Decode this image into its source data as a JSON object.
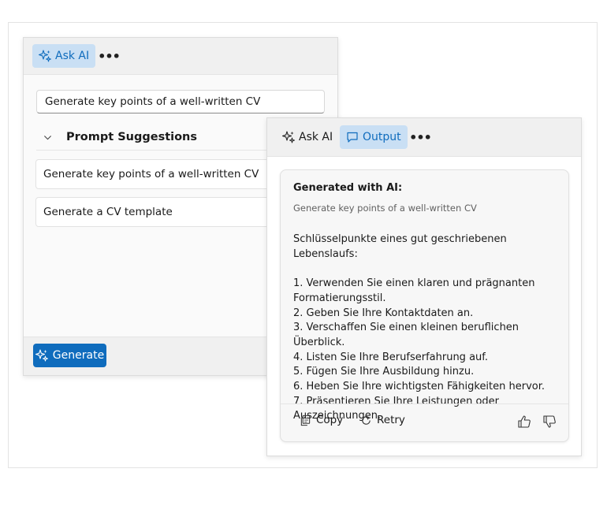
{
  "left_panel": {
    "toolbar": {
      "ask_ai_label": "Ask AI",
      "more_label": "•••"
    },
    "prompt_input": {
      "value": "Generate key points of a well-written CV"
    },
    "suggestions": {
      "title": "Prompt Suggestions",
      "items": [
        {
          "label": "Generate key points of a well-written CV"
        },
        {
          "label": "Generate a CV template"
        }
      ]
    },
    "footer": {
      "generate_label": "Generate"
    }
  },
  "right_panel": {
    "toolbar": {
      "ask_ai_label": "Ask AI",
      "output_label": "Output",
      "more_label": "•••"
    },
    "output": {
      "title": "Generated with AI:",
      "prompt": "Generate key points of a well-written CV",
      "intro": "Schlüsselpunkte eines gut geschriebenen Lebenslaufs:",
      "points": [
        "1. Verwenden Sie einen klaren und prägnanten Formatierungsstil.",
        "2. Geben Sie Ihre Kontaktdaten an.",
        "3. Verschaffen Sie einen kleinen beruflichen Überblick.",
        "4. Listen Sie Ihre Berufserfahrung auf.",
        "5. Fügen Sie Ihre Ausbildung hinzu.",
        "6. Heben Sie Ihre wichtigsten Fähigkeiten hervor.",
        "7. Präsentieren Sie Ihre Leistungen oder Auszeichnungen."
      ],
      "actions": {
        "copy_label": "Copy",
        "retry_label": "Retry"
      }
    }
  },
  "colors": {
    "accent": "#0f6cbd",
    "active_bg": "#c9dff4"
  }
}
